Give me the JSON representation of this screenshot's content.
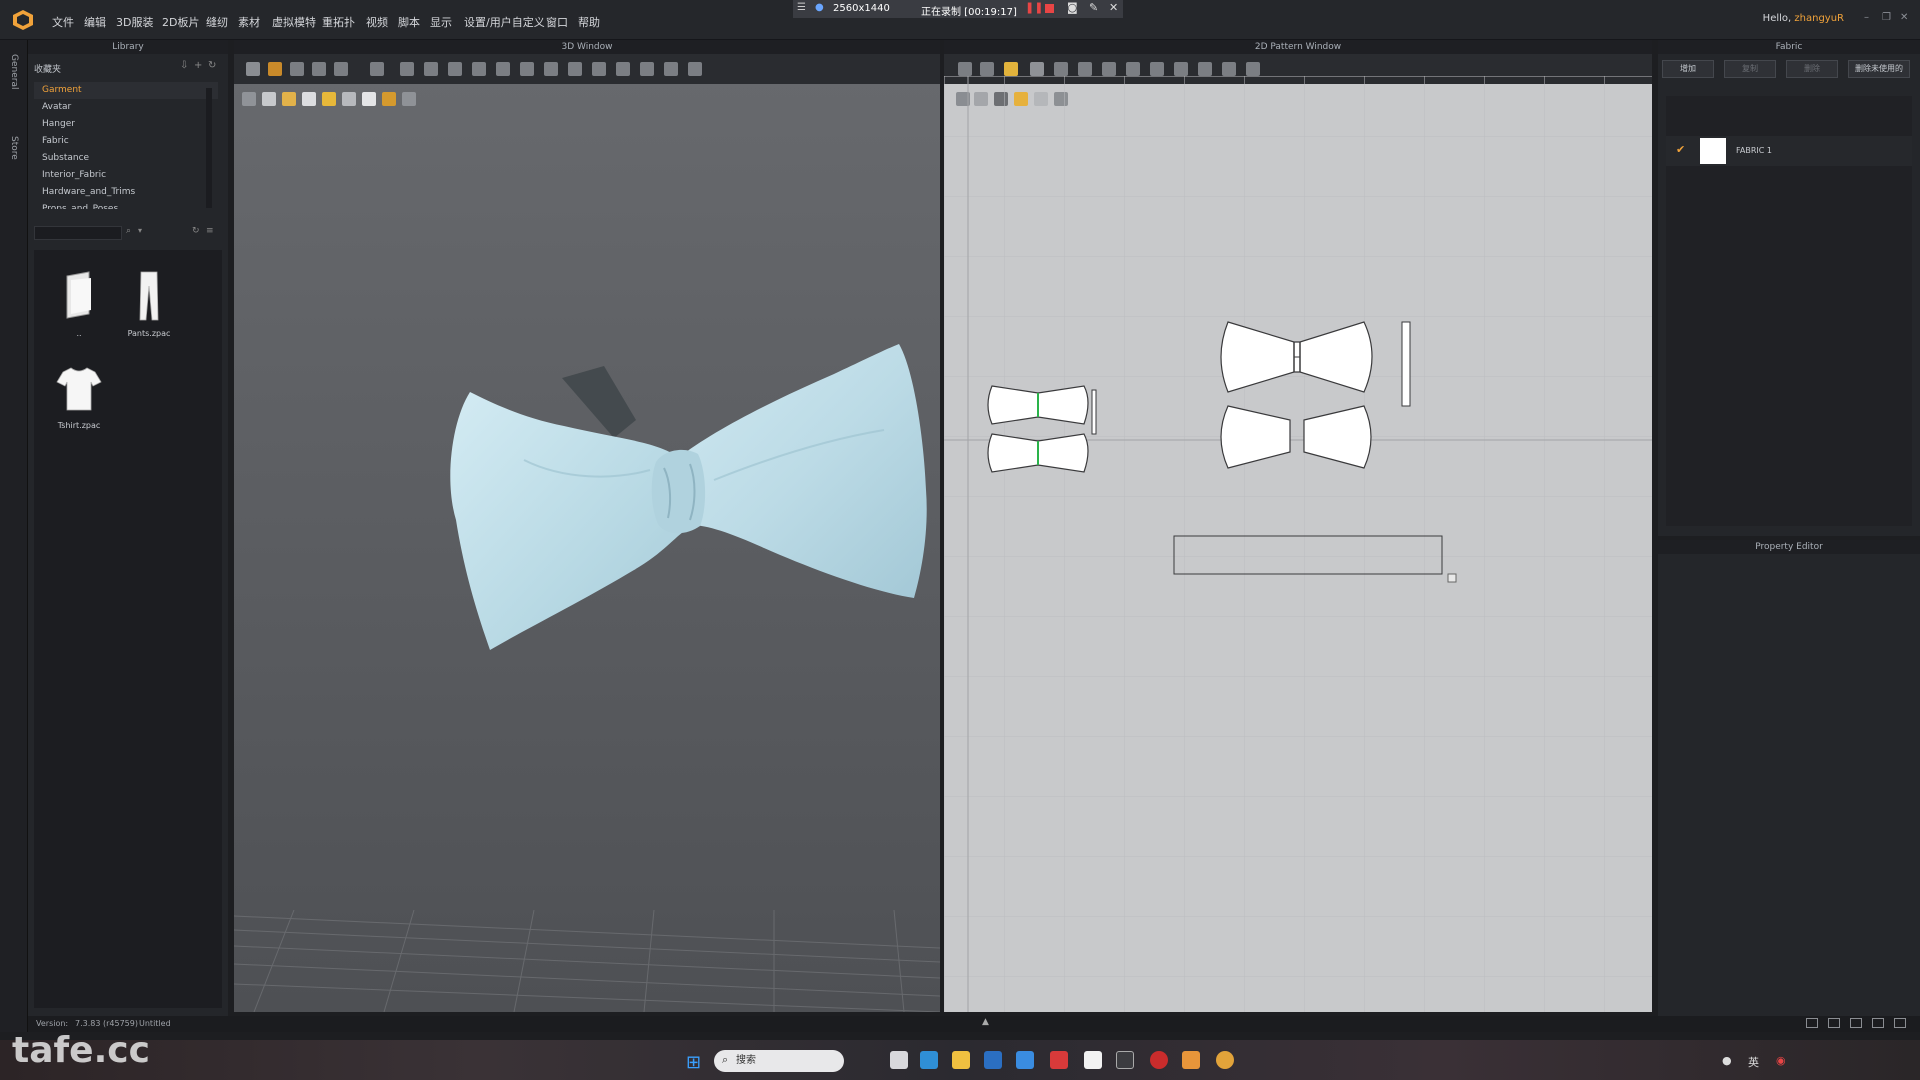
{
  "menubar": {
    "items": [
      "文件",
      "编辑",
      "3D服装",
      "2D板片",
      "缝纫",
      "素材",
      "虚拟模特",
      "重拓扑",
      "视频",
      "脚本",
      "显示",
      "设置/用户自定义",
      "窗口",
      "帮助"
    ],
    "recording": {
      "resolution": "2560x1440",
      "status": "正在录制 [00:19:17]"
    },
    "greeting": "Hello,",
    "username": "zhangyuR"
  },
  "sidestrip": {
    "tab1": "General",
    "tab2": "Store"
  },
  "library": {
    "title": "Library",
    "favorites_label": "收藏夹",
    "tree": [
      "Garment",
      "Avatar",
      "Hanger",
      "Fabric",
      "Substance",
      "Interior_Fabric",
      "Hardware_and_Trims",
      "Props_and_Poses"
    ],
    "selected_tree_item": "Garment",
    "files": [
      {
        "name": "..",
        "icon": "folder-icon"
      },
      {
        "name": "Pants.zpac",
        "icon": "pants-icon"
      },
      {
        "name": "Tshirt.zpac",
        "icon": "tshirt-icon"
      }
    ]
  },
  "win3d": {
    "title": "3D Window"
  },
  "win2d": {
    "title": "2D Pattern Window"
  },
  "fabric": {
    "title": "Fabric",
    "buttons": [
      "增加",
      "复制",
      "删除",
      "删除未使用的"
    ],
    "items": [
      {
        "name": "FABRIC 1",
        "color": "#ffffff"
      }
    ]
  },
  "property_editor": {
    "title": "Property Editor"
  },
  "status": {
    "version_label": "Version:",
    "version": "7.3.83 (r45759)",
    "file": "Untitled"
  },
  "taskbar": {
    "search_placeholder": "搜索"
  },
  "watermark": "tafe.cc",
  "colors": {
    "accent": "#f0a23a",
    "bowtie": "#c3e0ea",
    "pattern_bg": "#c8c9cb"
  }
}
